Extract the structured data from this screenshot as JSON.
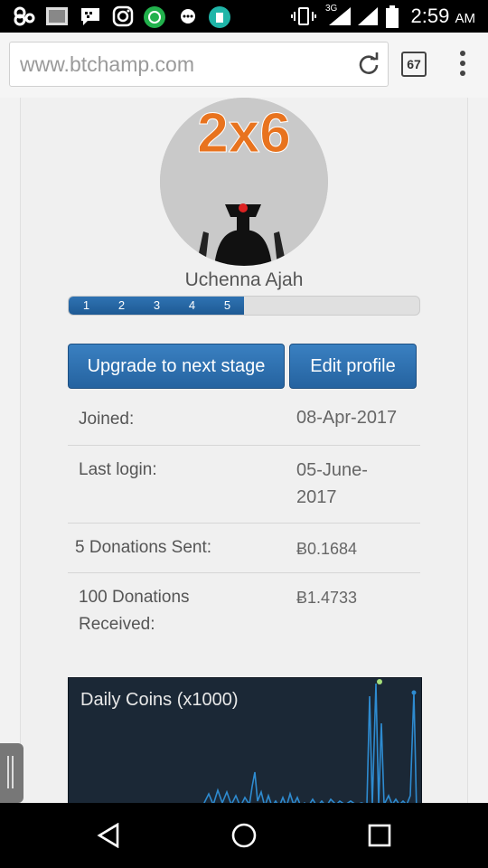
{
  "status_bar": {
    "network": "3G",
    "time": "2:59",
    "ampm": "AM"
  },
  "browser": {
    "url": "www.btchamp.com",
    "tab_count": "67"
  },
  "profile": {
    "avatar_text": "2x6",
    "name": "Uchenna Ajah",
    "stages": [
      "1",
      "2",
      "3",
      "4",
      "5"
    ],
    "stage_progress": 0.5
  },
  "actions": {
    "upgrade_label": "Upgrade to next stage",
    "edit_label": "Edit profile"
  },
  "stats": [
    {
      "label": "Joined:",
      "value": "08-Apr-2017"
    },
    {
      "label": "Last login:",
      "value": "05-June-2017"
    },
    {
      "label": "5 Donations Sent:",
      "value": "Ƀ0.1684"
    },
    {
      "label": "100 Donations Received:",
      "value": "Ƀ1.4733"
    }
  ],
  "chart_data": {
    "type": "line",
    "title": "Daily Coins (x1000)",
    "color": "#2e8bd0",
    "highlight_color": "#a6e07a"
  }
}
